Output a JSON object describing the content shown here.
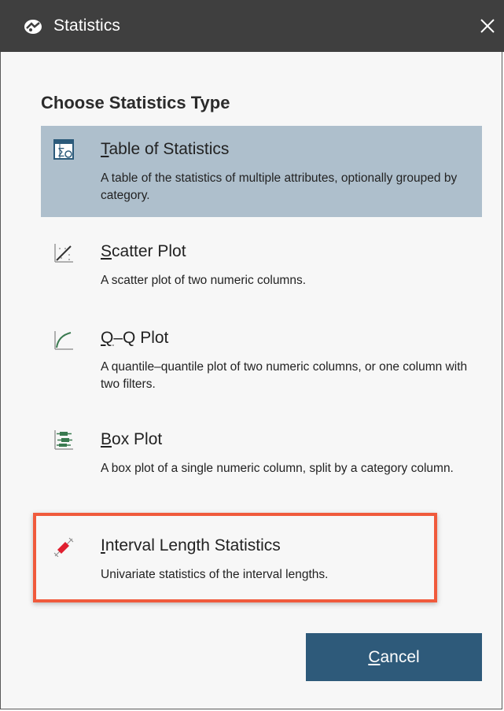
{
  "window": {
    "title": "Statistics",
    "app_icon": "app-logo-icon",
    "close_icon": "close-icon"
  },
  "heading": "Choose Statistics Type",
  "options": [
    {
      "mnemonic": "T",
      "rest": "able of Statistics",
      "description": "A table of the statistics of multiple attributes, optionally grouped by category.",
      "icon": "table-sigma-icon",
      "selected": true
    },
    {
      "mnemonic": "S",
      "rest": "catter Plot",
      "description": "A scatter plot of two numeric columns.",
      "icon": "scatter-plot-icon",
      "selected": false
    },
    {
      "mnemonic": "Q",
      "rest": "–Q Plot",
      "description": "A quantile–quantile plot of two numeric columns, or one column with two filters.",
      "icon": "qq-plot-icon",
      "selected": false
    },
    {
      "mnemonic": "B",
      "rest": "ox Plot",
      "description": "A box plot of a single numeric column, split by a category column.",
      "icon": "box-plot-icon",
      "selected": false
    },
    {
      "mnemonic": "I",
      "rest": "nterval Length Statistics",
      "description": "Univariate statistics of the interval lengths.",
      "icon": "interval-length-icon",
      "selected": false,
      "highlighted": true
    }
  ],
  "cancel": {
    "mnemonic": "C",
    "rest": "ancel"
  },
  "colors": {
    "titlebar": "#3f3f3f",
    "selected_bg": "#aebfcc",
    "highlight_border": "#f05a3c",
    "button_bg": "#2e5a7a"
  }
}
